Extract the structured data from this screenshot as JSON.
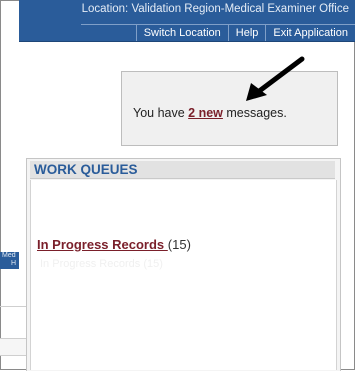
{
  "header": {
    "location_text": "Location: Validation Region-Medical Examiner Office",
    "nav": [
      "Switch Location",
      "Help",
      "Exit Application"
    ]
  },
  "messages": {
    "prefix": "You have ",
    "link": "2 new",
    "suffix": " messages."
  },
  "work_queues": {
    "title": "WORK QUEUES",
    "items": [
      {
        "label": "In Progress Records ",
        "count": "(15)"
      }
    ],
    "faded_item": "In Progress Records (15)"
  },
  "background_window": {
    "location_fragment": "Med",
    "nav_fragment": "H"
  },
  "colors": {
    "header_blue": "#2a5c9a",
    "link_maroon": "#7a1f2a"
  }
}
